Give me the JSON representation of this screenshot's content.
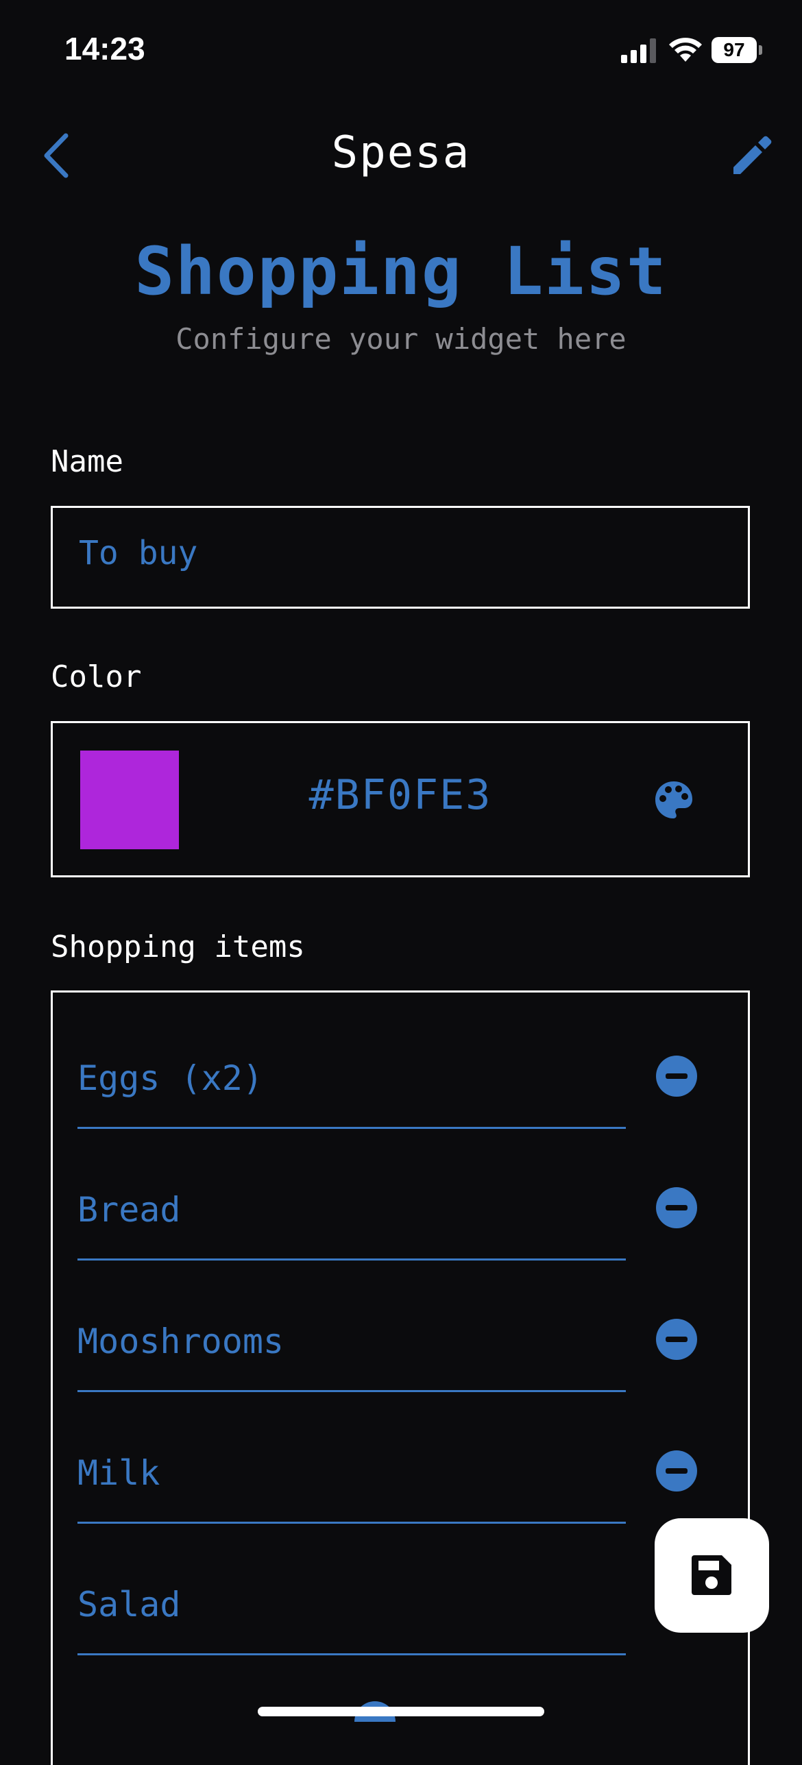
{
  "status_bar": {
    "time": "14:23",
    "battery": "97"
  },
  "nav": {
    "title": "Spesa"
  },
  "header": {
    "title": "Shopping List",
    "subtitle": "Configure your widget here"
  },
  "name_section": {
    "label": "Name",
    "value": "To buy"
  },
  "color_section": {
    "label": "Color",
    "hex": "#BF0FE3",
    "swatch_color": "#ae26db"
  },
  "items_section": {
    "label": "Shopping items",
    "items": [
      "Eggs (x2)",
      "Bread",
      "Mooshrooms",
      "Milk",
      "Salad"
    ]
  },
  "colors": {
    "accent": "#3a78c3",
    "background": "#0b0b0d"
  },
  "icons": {
    "back": "chevron-left-icon",
    "edit": "pencil-icon",
    "palette": "palette-icon",
    "remove": "minus-circle-icon",
    "save": "floppy-disk-icon"
  }
}
